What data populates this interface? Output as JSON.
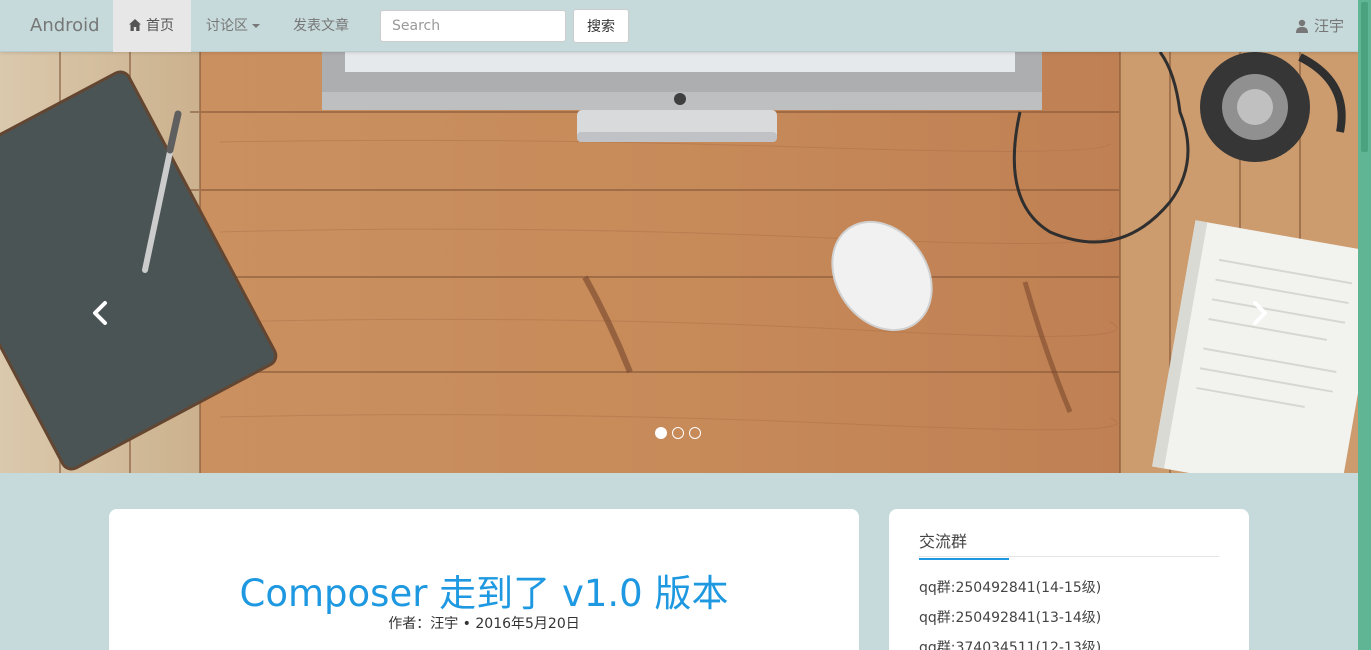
{
  "navbar": {
    "brand": "Android",
    "home_label": "首页",
    "forum_label": "讨论区",
    "post_label": "发表文章",
    "search_placeholder": "Search",
    "search_button": "搜索",
    "user_name": "汪宇"
  },
  "carousel": {
    "slide_count": 3,
    "active_index": 0
  },
  "post": {
    "title": "Composer 走到了 v1.0 版本",
    "meta": "作者：汪宇 • 2016年5月20日"
  },
  "sidebar": {
    "title": "交流群",
    "items": [
      {
        "label": "qq群:250492841(14-15级)"
      },
      {
        "label": "qq群:250492841(13-14级)"
      },
      {
        "label": "qq群:374034511(12-13级)"
      }
    ]
  },
  "colors": {
    "background": "#c7dadb",
    "accent": "#1e98e0",
    "scrollbar": "#5fb594"
  },
  "icons": {
    "home": "home-icon",
    "user": "user-icon",
    "prev": "chevron-left-icon",
    "next": "chevron-right-icon"
  }
}
